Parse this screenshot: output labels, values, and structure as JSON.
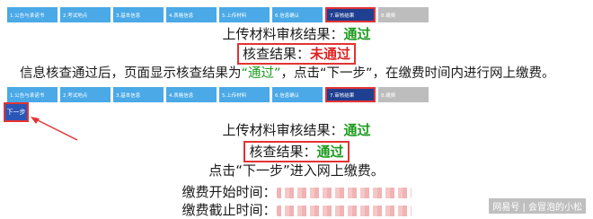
{
  "steps": [
    "1.公告与承诺书",
    "2.考试地点",
    "3.基本信息",
    "4.表格信息",
    "5.上传材料",
    "6.信息确认",
    "7.审核结果",
    "8.缴费"
  ],
  "active_step": "7.审核结果",
  "top": {
    "upload_label": "上传材料审核结果：",
    "upload_status": "通过",
    "check_label": "核查结果：",
    "check_status": "未通过"
  },
  "info": {
    "prefix": "信息核查通过后，页面显示核查结果为",
    "q_open": "“",
    "status": "通过",
    "q_close": "”",
    "suffix": "，点击“下一步”，在缴费时间内进行网上缴费。"
  },
  "next_button": "下一步",
  "bottom": {
    "upload_label": "上传材料审核结果：",
    "upload_status": "通过",
    "check_label": "核查结果：",
    "check_status": "通过",
    "hint": "点击“下一步”进入网上缴费。",
    "fee_start_label": "缴费开始时间：",
    "fee_end_label": "缴费截止时间："
  },
  "watermark": "网易号 | 会冒泡的小松",
  "colors": {
    "step_blue": "#4aa9e6",
    "step_active": "#1f3f91",
    "highlight_red": "#e23333",
    "pass_green": "#1a9b1a",
    "fail_red": "#e02020"
  }
}
